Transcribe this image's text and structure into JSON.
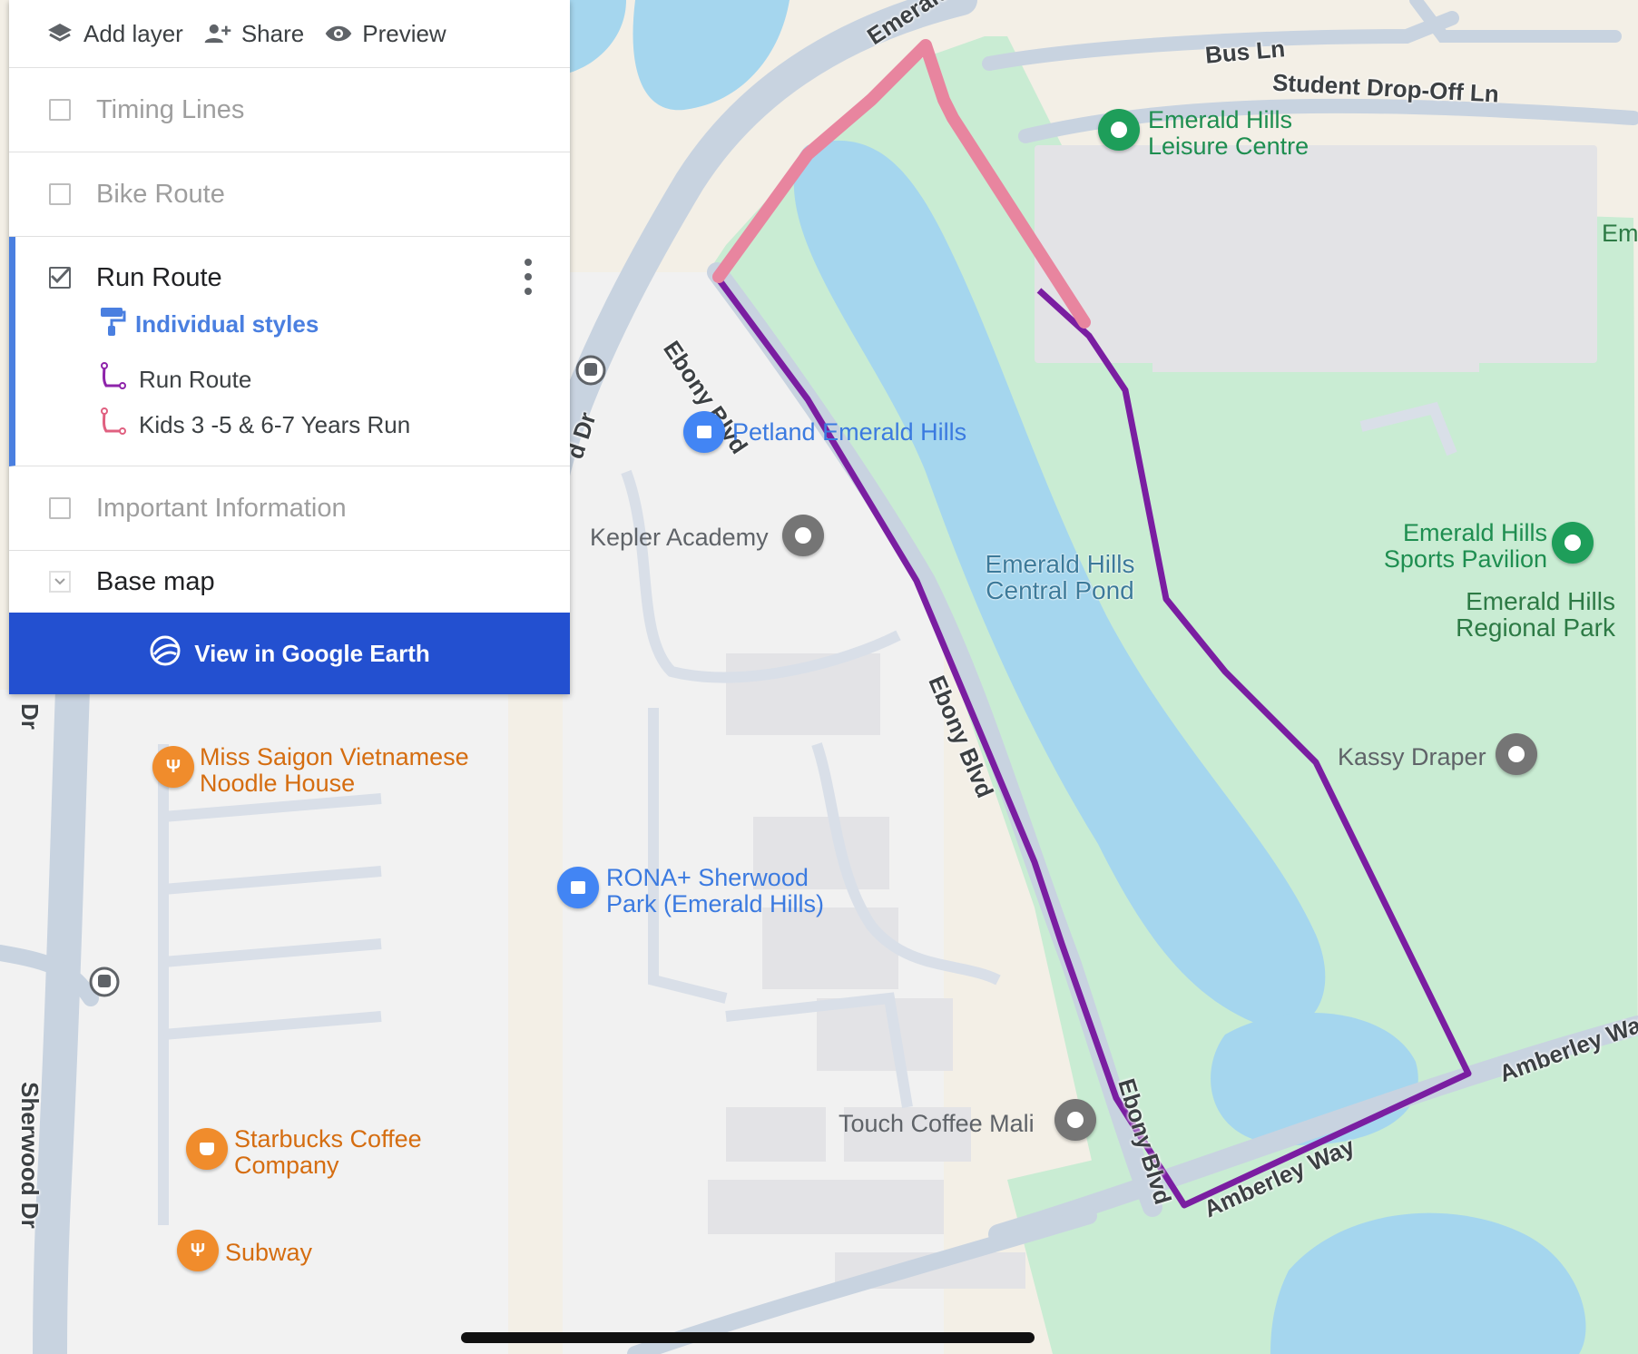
{
  "toolbar": {
    "add_layer": "Add layer",
    "share": "Share",
    "preview": "Preview"
  },
  "layers": {
    "timing_lines": {
      "label": "Timing Lines",
      "checked": false
    },
    "bike_route": {
      "label": "Bike Route",
      "checked": false
    },
    "run_route": {
      "label": "Run Route",
      "checked": true,
      "styles_label": "Individual styles",
      "features": [
        {
          "label": "Run Route"
        },
        {
          "label": "Kids 3 -5 & 6-7 Years Run"
        }
      ]
    },
    "important_information": {
      "label": "Important Information",
      "checked": false
    },
    "base_map": {
      "label": "Base map"
    }
  },
  "earth_button": {
    "label": "View in Google Earth"
  },
  "map": {
    "roads": {
      "emerald": "Emerald Dr",
      "bus_ln": "Bus Ln",
      "student_dropoff": "Student Drop-Off Ln",
      "ebony_1": "Ebony Blvd",
      "ebony_2": "Ebony Blvd",
      "ebony_3": "Ebony Blvd",
      "amberley_1": "Amberley Way",
      "amberley_2": "Amberley Way",
      "sherwood": "Sherwood Dr",
      "d_dr": "d Dr",
      "dr_small": "Dr",
      "em_cut": "Em"
    },
    "places": {
      "leisure_centre": "Emerald Hills Leisure Centre",
      "petland": "Petland Emerald Hills",
      "kepler": "Kepler Academy",
      "central_pond": "Emerald Hills Central Pond",
      "sports_pavilion": "Emerald Hills Sports Pavilion",
      "regional_park": "Emerald Hills Regional Park",
      "kassy": "Kassy Draper",
      "miss_saigon": "Miss Saigon Vietnamese Noodle House",
      "rona": "RONA+ Sherwood Park (Emerald Hills)",
      "touch_coffee": "Touch Coffee Mali",
      "starbucks": "Starbucks Coffee Company",
      "subway": "Subway"
    },
    "icons": {
      "layer": "layers-icon",
      "share": "person-add-icon",
      "preview": "eye-icon",
      "styles": "paint-roller-icon",
      "route": "route-line-icon",
      "earth": "google-earth-icon",
      "transit": "bus-stop-icon"
    },
    "colors": {
      "route": "#7a1ea1",
      "kids_route": "#e8859f",
      "water": "#a5d6ee",
      "park": "#c9ecd3",
      "road": "#c8d3e0",
      "accent": "#2350d0"
    }
  }
}
